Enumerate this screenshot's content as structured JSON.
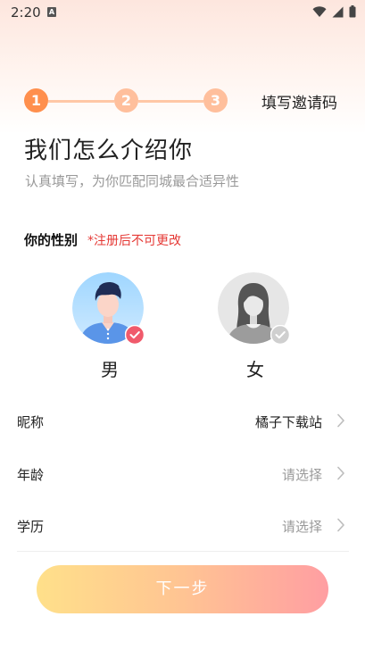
{
  "status_bar": {
    "time": "2:20",
    "a_badge": "A"
  },
  "steps": [
    "1",
    "2",
    "3"
  ],
  "current_step": 1,
  "invite_code_label": "填写邀请码",
  "title": "我们怎么介绍你",
  "subtitle": "认真填写，为你匹配同城最合适异性",
  "gender": {
    "label": "你的性别",
    "note": "*注册后不可更改",
    "male": "男",
    "female": "女",
    "selected": "男"
  },
  "form": {
    "nickname": {
      "label": "昵称",
      "value": "橘子下载站"
    },
    "age": {
      "label": "年龄",
      "placeholder": "请选择"
    },
    "education": {
      "label": "学历",
      "placeholder": "请选择"
    }
  },
  "next_button": "下一步",
  "colors": {
    "accent_orange": "#ff8f4d",
    "step_inactive": "#ffbf9c",
    "warning_red": "#e53935",
    "check_red": "#f05a6b"
  }
}
